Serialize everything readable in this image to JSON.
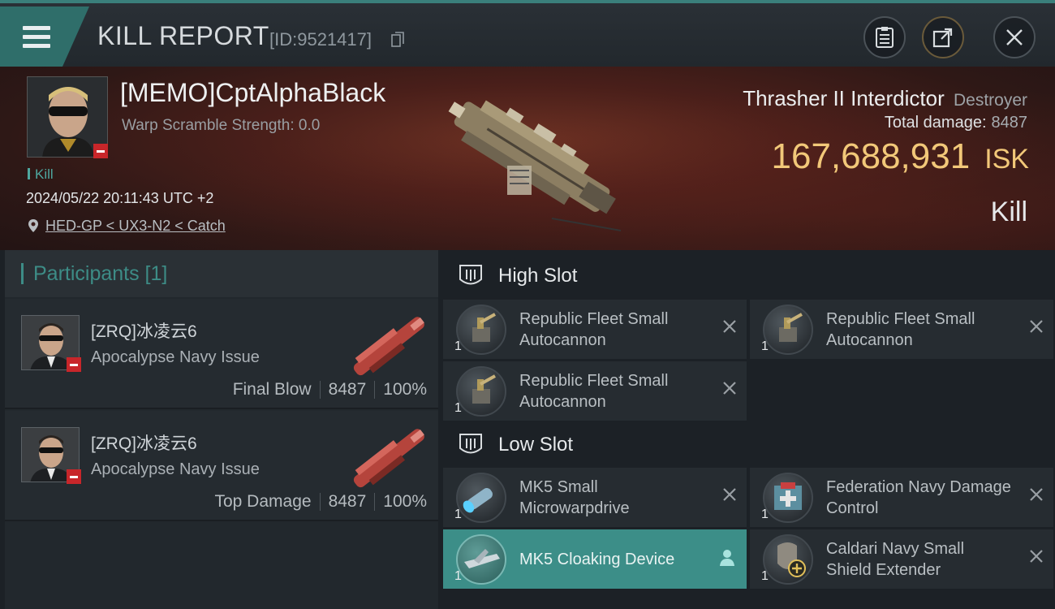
{
  "header": {
    "title": "KILL REPORT",
    "report_id": "[ID:9521417]"
  },
  "victim": {
    "name": "[MEMO]CptAlphaBlack",
    "scramble": "Warp Scramble Strength: 0.0",
    "tag": "Kill",
    "datetime": "2024/05/22 20:11:43 UTC +2",
    "location": "HED-GP < UX3-N2 < Catch",
    "ship_name": "Thrasher II Interdictor",
    "ship_class": "Destroyer",
    "total_damage_label": "Total damage:",
    "total_damage": "8487",
    "isk_value": "167,688,931",
    "isk_unit": "ISK",
    "result": "Kill"
  },
  "participants": {
    "header": "Participants [1]",
    "rows": [
      {
        "name": "[ZRQ]冰凌云6",
        "ship": "Apocalypse Navy Issue",
        "role": "Final Blow",
        "damage": "8487",
        "percent": "100%"
      },
      {
        "name": "[ZRQ]冰凌云6",
        "ship": "Apocalypse Navy Issue",
        "role": "Top Damage",
        "damage": "8487",
        "percent": "100%"
      }
    ]
  },
  "slots": {
    "high": {
      "title": "High Slot",
      "items": [
        {
          "name": "Republic Fleet Small Autocannon",
          "qty": "1"
        },
        {
          "name": "Republic Fleet Small Autocannon",
          "qty": "1"
        },
        {
          "name": "Republic Fleet Small Autocannon",
          "qty": "1"
        }
      ]
    },
    "low": {
      "title": "Low Slot",
      "items": [
        {
          "name": "MK5 Small Microwarpdrive",
          "qty": "1"
        },
        {
          "name": "Federation Navy Damage Control",
          "qty": "1"
        },
        {
          "name": "MK5 Cloaking Device",
          "qty": "1"
        },
        {
          "name": "Caldari Navy Small Shield Extender",
          "qty": "1"
        }
      ]
    }
  },
  "colors": {
    "accent": "#3c8e88",
    "isk": "#f2c879",
    "negative": "#c8262a"
  },
  "icons": [
    "menu-icon",
    "copy-icon",
    "clipboard-icon",
    "share-icon",
    "close-icon",
    "location-pin-icon",
    "slot-icon",
    "remove-icon",
    "person-icon"
  ]
}
